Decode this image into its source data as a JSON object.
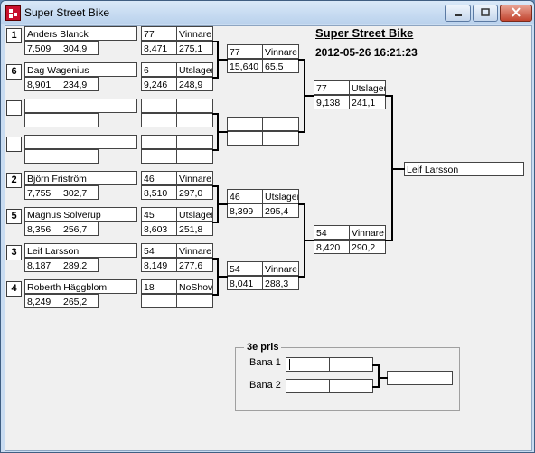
{
  "window": {
    "title": "Super Street Bike",
    "buttons": {
      "minimize": "minimize",
      "maximize": "maximize",
      "close": "close"
    }
  },
  "header": {
    "title": "Super Street Bike",
    "datetime": "2012-05-26 16:21:23"
  },
  "round1": [
    {
      "seed": "1",
      "name": "Anders Blanck",
      "time": "7,509",
      "speed": "304,9",
      "bike": "77",
      "result": "Vinnare",
      "time2": "8,471",
      "speed2": "275,1"
    },
    {
      "seed": "6",
      "name": "Dag Wagenius",
      "time": "8,901",
      "speed": "234,9",
      "bike": "6",
      "result": "Utslagen",
      "time2": "9,246",
      "speed2": "248,9"
    },
    {
      "seed": "",
      "name": "",
      "time": "",
      "speed": "",
      "bike": "",
      "result": "",
      "time2": "",
      "speed2": ""
    },
    {
      "seed": "",
      "name": "",
      "time": "",
      "speed": "",
      "bike": "",
      "result": "",
      "time2": "",
      "speed2": ""
    },
    {
      "seed": "2",
      "name": "Björn Friström",
      "time": "7,755",
      "speed": "302,7",
      "bike": "46",
      "result": "Vinnare",
      "time2": "8,510",
      "speed2": "297,0"
    },
    {
      "seed": "5",
      "name": "Magnus Sölverup",
      "time": "8,356",
      "speed": "256,7",
      "bike": "45",
      "result": "Utslagen",
      "time2": "8,603",
      "speed2": "251,8"
    },
    {
      "seed": "3",
      "name": "Leif Larsson",
      "time": "8,187",
      "speed": "289,2",
      "bike": "54",
      "result": "Vinnare",
      "time2": "8,149",
      "speed2": "277,6"
    },
    {
      "seed": "4",
      "name": "Roberth Häggblom",
      "time": "8,249",
      "speed": "265,2",
      "bike": "18",
      "result": "NoShow",
      "time2": "",
      "speed2": ""
    }
  ],
  "round2": [
    {
      "bike": "77",
      "result": "Vinnare",
      "time": "15,640",
      "speed": "65,5"
    },
    {
      "bike": "",
      "result": "",
      "time": "",
      "speed": ""
    },
    {
      "bike": "46",
      "result": "Utslagen",
      "time": "8,399",
      "speed": "295,4"
    },
    {
      "bike": "54",
      "result": "Vinnare",
      "time": "8,041",
      "speed": "288,3"
    }
  ],
  "round3": [
    {
      "bike": "77",
      "result": "Utslagen",
      "time": "9,138",
      "speed": "241,1"
    },
    {
      "bike": "54",
      "result": "Vinnare",
      "time": "8,420",
      "speed": "290,2"
    }
  ],
  "winner": "Leif Larsson",
  "third": {
    "legend": "3e pris",
    "lane1_label": "Bana 1",
    "lane2_label": "Bana 2",
    "lane1_a": "",
    "lane1_b": "",
    "lane2_a": "",
    "lane2_b": "",
    "result": ""
  }
}
